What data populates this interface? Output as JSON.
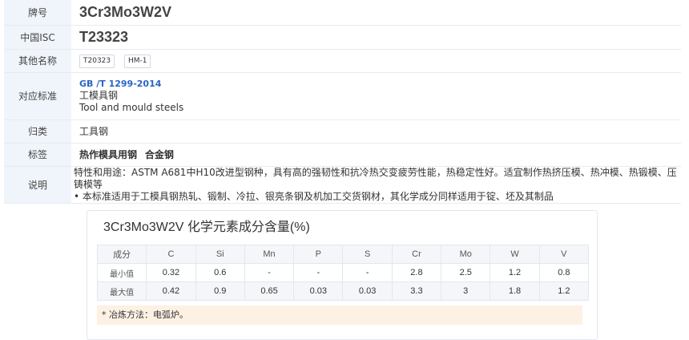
{
  "info": {
    "grade_label": "牌号",
    "grade_value": "3Cr3Mo3W2V",
    "china_isc_label": "中国ISC",
    "china_isc_value": "T23323",
    "other_names_label": "其他名称",
    "other_names": [
      "T20323",
      "HM-1"
    ],
    "standard_label": "对应标准",
    "standard_code": "GB /T 1299-2014",
    "standard_cn": "工模具钢",
    "standard_en": "Tool and mould steels",
    "category_label": "归类",
    "category_value": "工具钢",
    "tags_label": "标签",
    "tags": [
      "热作模具用钢",
      "合金钢"
    ],
    "desc_label": "说明",
    "desc_line1": "特性和用途：ASTM A681中H10改进型钢种，具有高的强韧性和抗冷热交变疲劳性能，热稳定性好。适宜制作热挤压模、热冲模、热锻模、压铸模等",
    "desc_line2": "• 本标准适用于工模具钢热轧、锻制、冷拉、银亮条钢及机加工交货钢材，其化学成分同样适用于锭、坯及其制品"
  },
  "composition": {
    "title": "3Cr3Mo3W2V 化学元素成分含量(%)",
    "headers": [
      "成分",
      "C",
      "Si",
      "Mn",
      "P",
      "S",
      "Cr",
      "Mo",
      "W",
      "V"
    ],
    "min_row": [
      "最小值",
      "0.32",
      "0.6",
      "-",
      "-",
      "-",
      "2.8",
      "2.5",
      "1.2",
      "0.8"
    ],
    "max_row": [
      "最大值",
      "0.42",
      "0.9",
      "0.65",
      "0.03",
      "0.03",
      "3.3",
      "3",
      "1.8",
      "1.2"
    ],
    "note": "* 冶炼方法：电弧炉。"
  }
}
